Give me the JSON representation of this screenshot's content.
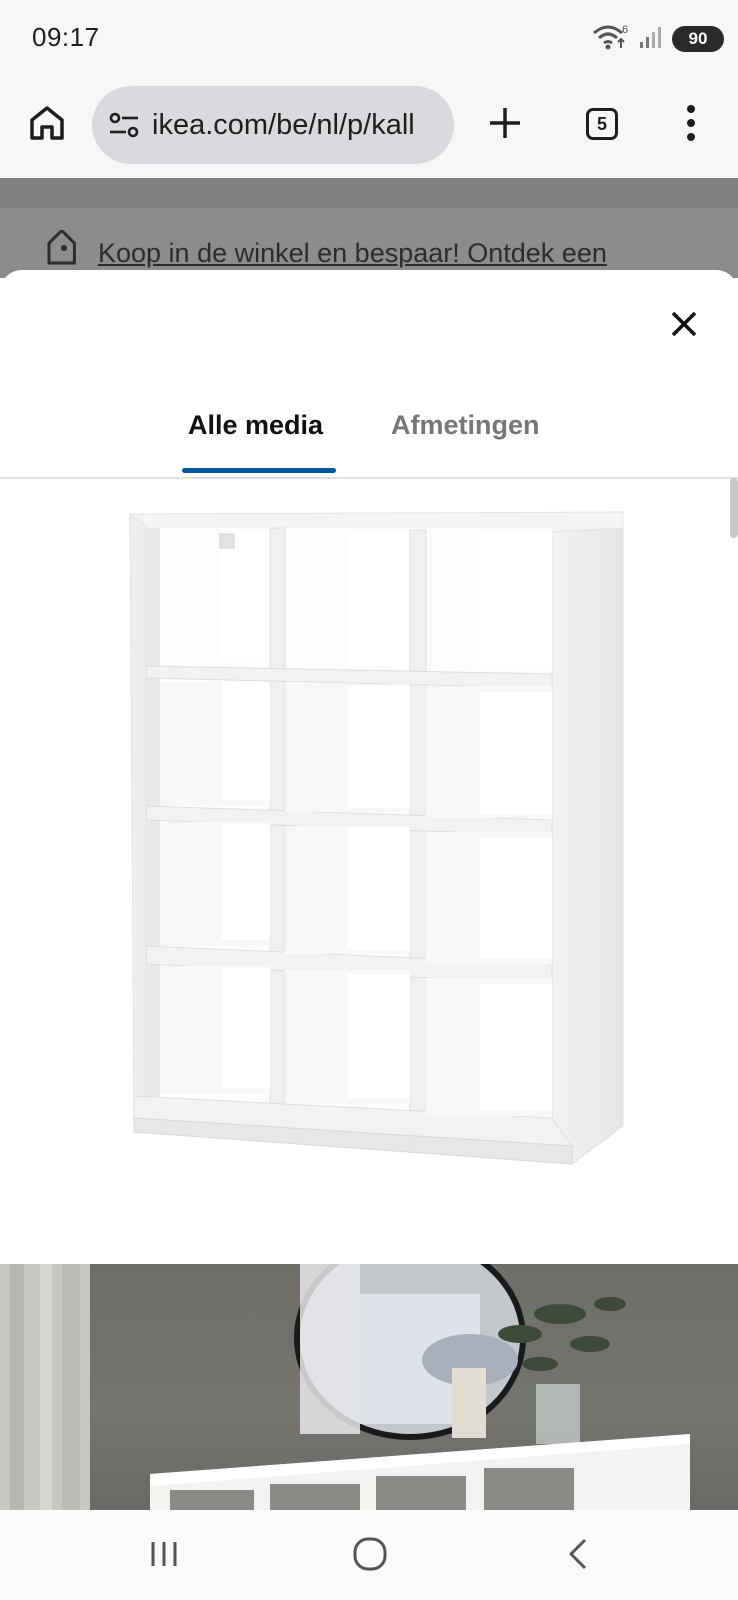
{
  "status_bar": {
    "time": "09:17",
    "wifi_label": "6",
    "battery": "90"
  },
  "browser": {
    "url": "ikea.com/be/nl/p/kall",
    "tab_count": "5",
    "icons": [
      "home-icon",
      "site-settings-icon",
      "plus-icon",
      "tab-switcher-icon",
      "more-vert-icon"
    ]
  },
  "page": {
    "promo_text": "Koop in de winkel en bespaar! Ontdek een"
  },
  "media_viewer": {
    "tabs": [
      {
        "label": "Alle media",
        "active": true
      },
      {
        "label": "Afmetingen",
        "active": false
      }
    ],
    "accent_color": "#0058a3",
    "items": [
      {
        "name": "kallax-shelf-product-image"
      },
      {
        "name": "room-scene-photo"
      }
    ]
  },
  "nav_bar": {
    "icons": [
      "recent-apps-icon",
      "home-circle-icon",
      "back-icon"
    ]
  }
}
